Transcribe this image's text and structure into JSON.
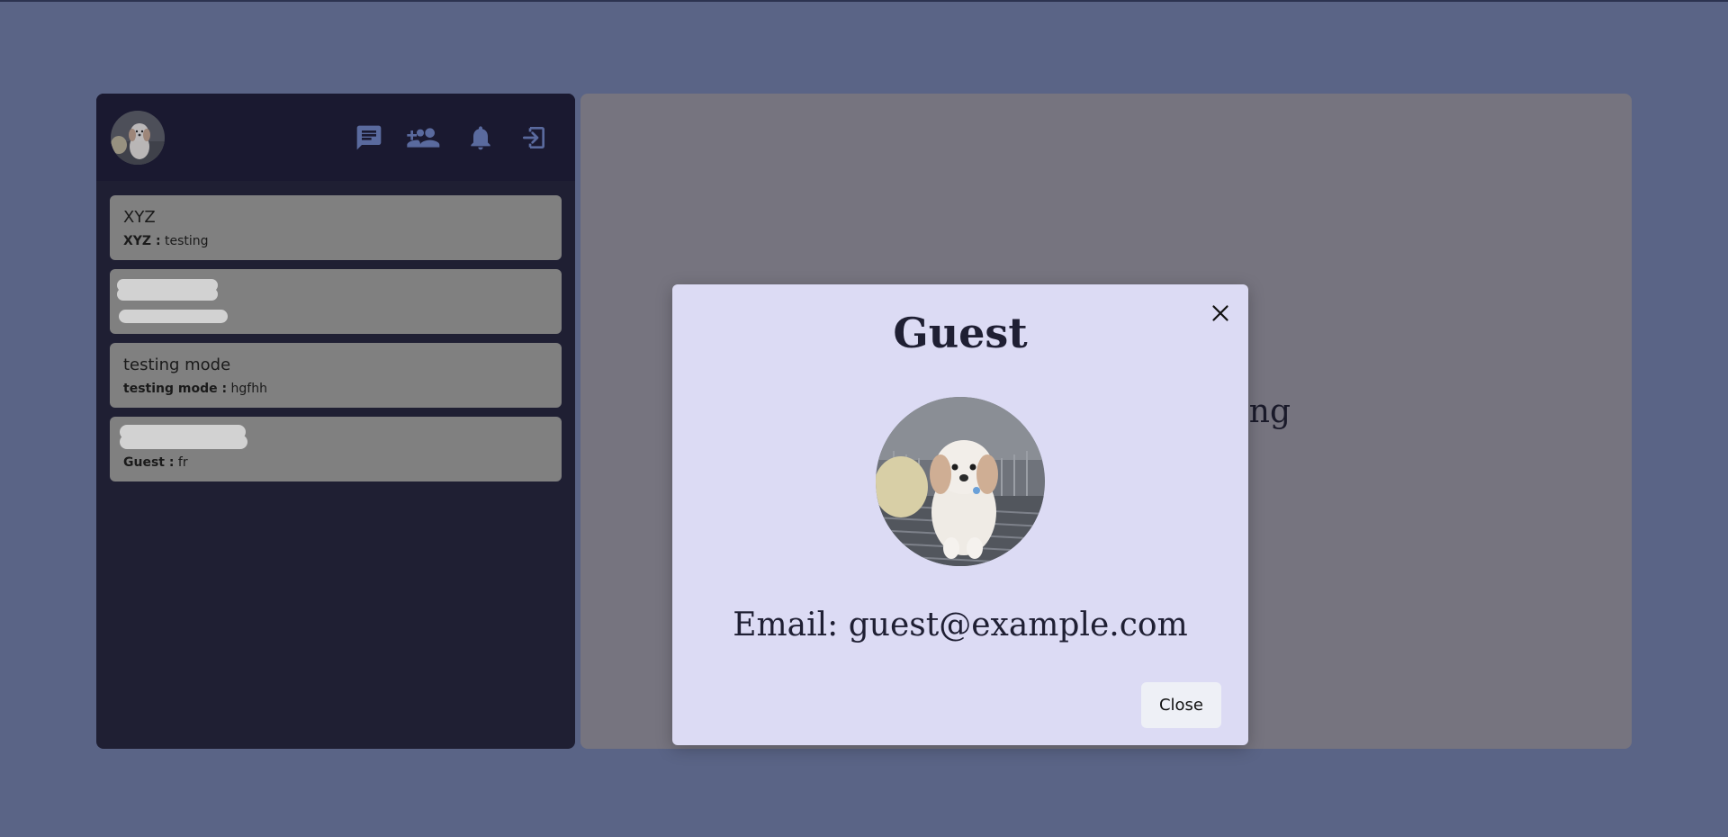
{
  "sidebar": {
    "header": {
      "icons": [
        {
          "icon": "message-icon",
          "action": "chats"
        },
        {
          "icon": "add-user-icon",
          "action": "add friend"
        },
        {
          "icon": "bell-icon",
          "action": "notifications"
        },
        {
          "icon": "logout-icon",
          "action": "logout"
        }
      ],
      "icon_color": "#5a6a9e"
    },
    "chats": [
      {
        "name": "XYZ",
        "sender": "XYZ :",
        "message": "testing"
      },
      {
        "name": "",
        "sender": "",
        "message": ""
      },
      {
        "name": "testing mode",
        "sender": "testing mode :",
        "message": "hgfhh"
      },
      {
        "name": "",
        "sender": "Guest :",
        "message": "fr"
      }
    ]
  },
  "main": {
    "prompt": "start chatting"
  },
  "modal": {
    "title": "Guest",
    "email": "Email: guest@example.com",
    "close_label": "Close"
  },
  "colors": {
    "background": "#5a6486",
    "sidebar": "#1f1f33",
    "chat_item": "#808080",
    "modal": "#dcdbf4"
  }
}
